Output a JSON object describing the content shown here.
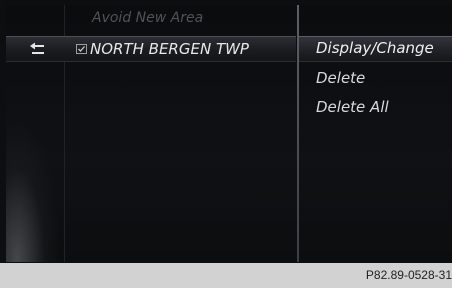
{
  "list": {
    "items": [
      {
        "label": "Avoid New Area",
        "state": "dimmed"
      },
      {
        "label": "NORTH BERGEN TWP",
        "state": "selected",
        "checkbox_icon": "checkbox-icon"
      }
    ],
    "back_icon": "back-arrow-icon"
  },
  "menu": {
    "items": [
      {
        "label": "Display/Change",
        "highlighted": true
      },
      {
        "label": "Delete"
      },
      {
        "label": "Delete All"
      }
    ]
  },
  "caption": "P82.89-0528-31"
}
